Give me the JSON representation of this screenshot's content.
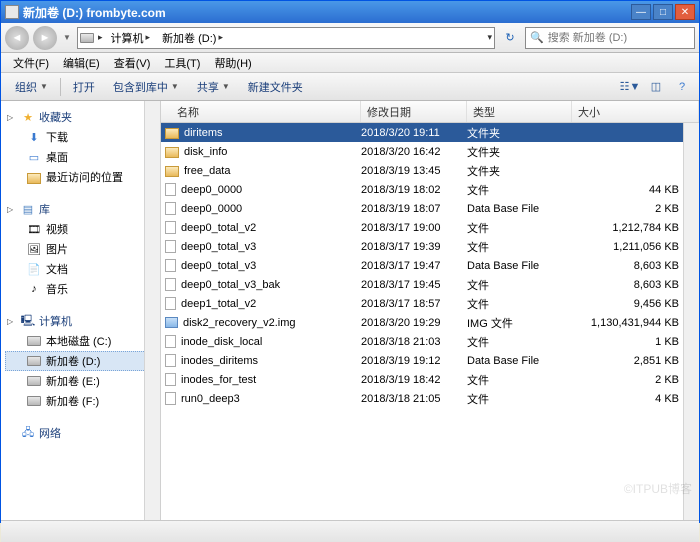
{
  "titlebar": {
    "title": "新加卷 (D:) frombyte.com"
  },
  "address": {
    "crumb1": "计算机",
    "crumb2": "新加卷 (D:)"
  },
  "search": {
    "placeholder": "搜索 新加卷 (D:)"
  },
  "menu": {
    "file": "文件(F)",
    "edit": "编辑(E)",
    "view": "查看(V)",
    "tool": "工具(T)",
    "help": "帮助(H)"
  },
  "toolbar": {
    "organize": "组织",
    "open": "打开",
    "include": "包含到库中",
    "share": "共享",
    "newfolder": "新建文件夹"
  },
  "sidebar": {
    "fav": {
      "label": "收藏夹",
      "items": [
        "下载",
        "桌面",
        "最近访问的位置"
      ]
    },
    "lib": {
      "label": "库",
      "items": [
        "视频",
        "图片",
        "文档",
        "音乐"
      ]
    },
    "computer": {
      "label": "计算机",
      "items": [
        "本地磁盘 (C:)",
        "新加卷 (D:)",
        "新加卷 (E:)",
        "新加卷 (F:)"
      ]
    },
    "network": {
      "label": "网络"
    }
  },
  "columns": {
    "name": "名称",
    "date": "修改日期",
    "type": "类型",
    "size": "大小"
  },
  "files": [
    {
      "name": "diritems",
      "date": "2018/3/20 19:11",
      "type": "文件夹",
      "size": "",
      "icon": "folder",
      "selected": true
    },
    {
      "name": "disk_info",
      "date": "2018/3/20 16:42",
      "type": "文件夹",
      "size": "",
      "icon": "folder"
    },
    {
      "name": "free_data",
      "date": "2018/3/19 13:45",
      "type": "文件夹",
      "size": "",
      "icon": "folder"
    },
    {
      "name": "deep0_0000",
      "date": "2018/3/19 18:02",
      "type": "文件",
      "size": "44 KB",
      "icon": "file"
    },
    {
      "name": "deep0_0000",
      "date": "2018/3/19 18:07",
      "type": "Data Base File",
      "size": "2 KB",
      "icon": "db"
    },
    {
      "name": "deep0_total_v2",
      "date": "2018/3/17 19:00",
      "type": "文件",
      "size": "1,212,784 KB",
      "icon": "file"
    },
    {
      "name": "deep0_total_v3",
      "date": "2018/3/17 19:39",
      "type": "文件",
      "size": "1,211,056 KB",
      "icon": "file"
    },
    {
      "name": "deep0_total_v3",
      "date": "2018/3/17 19:47",
      "type": "Data Base File",
      "size": "8,603 KB",
      "icon": "db"
    },
    {
      "name": "deep0_total_v3_bak",
      "date": "2018/3/17 19:45",
      "type": "文件",
      "size": "8,603 KB",
      "icon": "file"
    },
    {
      "name": "deep1_total_v2",
      "date": "2018/3/17 18:57",
      "type": "文件",
      "size": "9,456 KB",
      "icon": "file"
    },
    {
      "name": "disk2_recovery_v2.img",
      "date": "2018/3/20 19:29",
      "type": "IMG 文件",
      "size": "1,130,431,944 KB",
      "icon": "img"
    },
    {
      "name": "inode_disk_local",
      "date": "2018/3/18 21:03",
      "type": "文件",
      "size": "1 KB",
      "icon": "file"
    },
    {
      "name": "inodes_diritems",
      "date": "2018/3/19 19:12",
      "type": "Data Base File",
      "size": "2,851 KB",
      "icon": "db"
    },
    {
      "name": "inodes_for_test",
      "date": "2018/3/19 18:42",
      "type": "文件",
      "size": "2 KB",
      "icon": "file"
    },
    {
      "name": "run0_deep3",
      "date": "2018/3/18 21:05",
      "type": "文件",
      "size": "4 KB",
      "icon": "file"
    }
  ],
  "watermark": "©ITPUB博客"
}
